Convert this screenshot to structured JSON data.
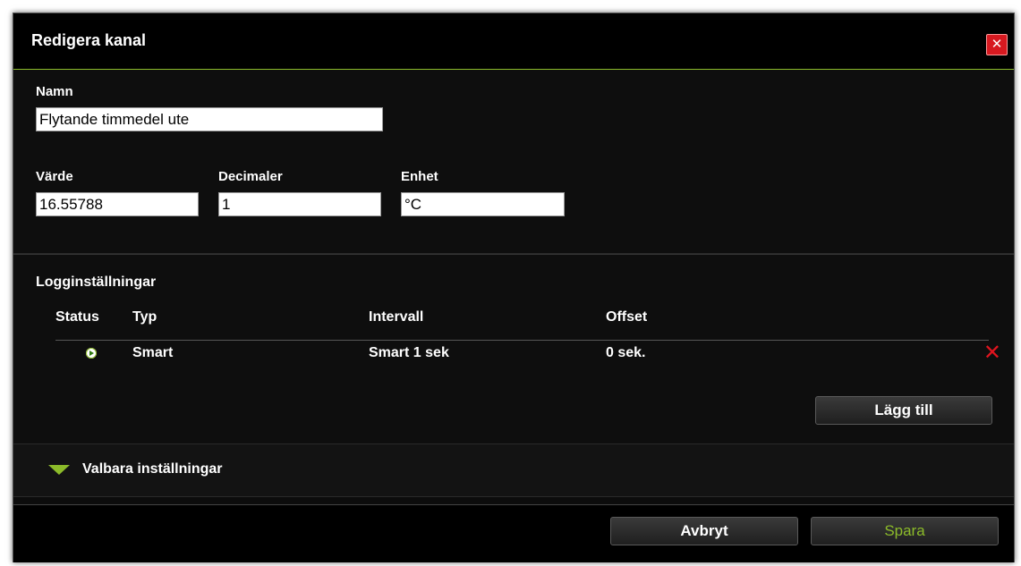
{
  "dialog": {
    "title": "Redigera kanal",
    "close_icon": "close-icon"
  },
  "basic": {
    "name_label": "Namn",
    "name_value": "Flytande timmedel ute",
    "value_label": "Värde",
    "value_value": "16.55788",
    "decimals_label": "Decimaler",
    "decimals_value": "1",
    "unit_label": "Enhet",
    "unit_value": "°C"
  },
  "logging": {
    "heading": "Logginställningar",
    "columns": [
      "Status",
      "Typ",
      "Intervall",
      "Offset"
    ],
    "rows": [
      {
        "status_icon": "play-icon",
        "type": "Smart",
        "interval": "Smart 1 sek",
        "offset": "0 sek.",
        "delete_icon": "delete-icon"
      }
    ],
    "add_button": "Lägg till"
  },
  "optional": {
    "label": "Valbara inställningar",
    "icon": "triangle-down-icon"
  },
  "footer": {
    "cancel_button": "Avbryt",
    "save_button": "Spara"
  },
  "colors": {
    "accent": "#8cbb2a",
    "delete": "#e0141e",
    "close": "#d71920"
  }
}
